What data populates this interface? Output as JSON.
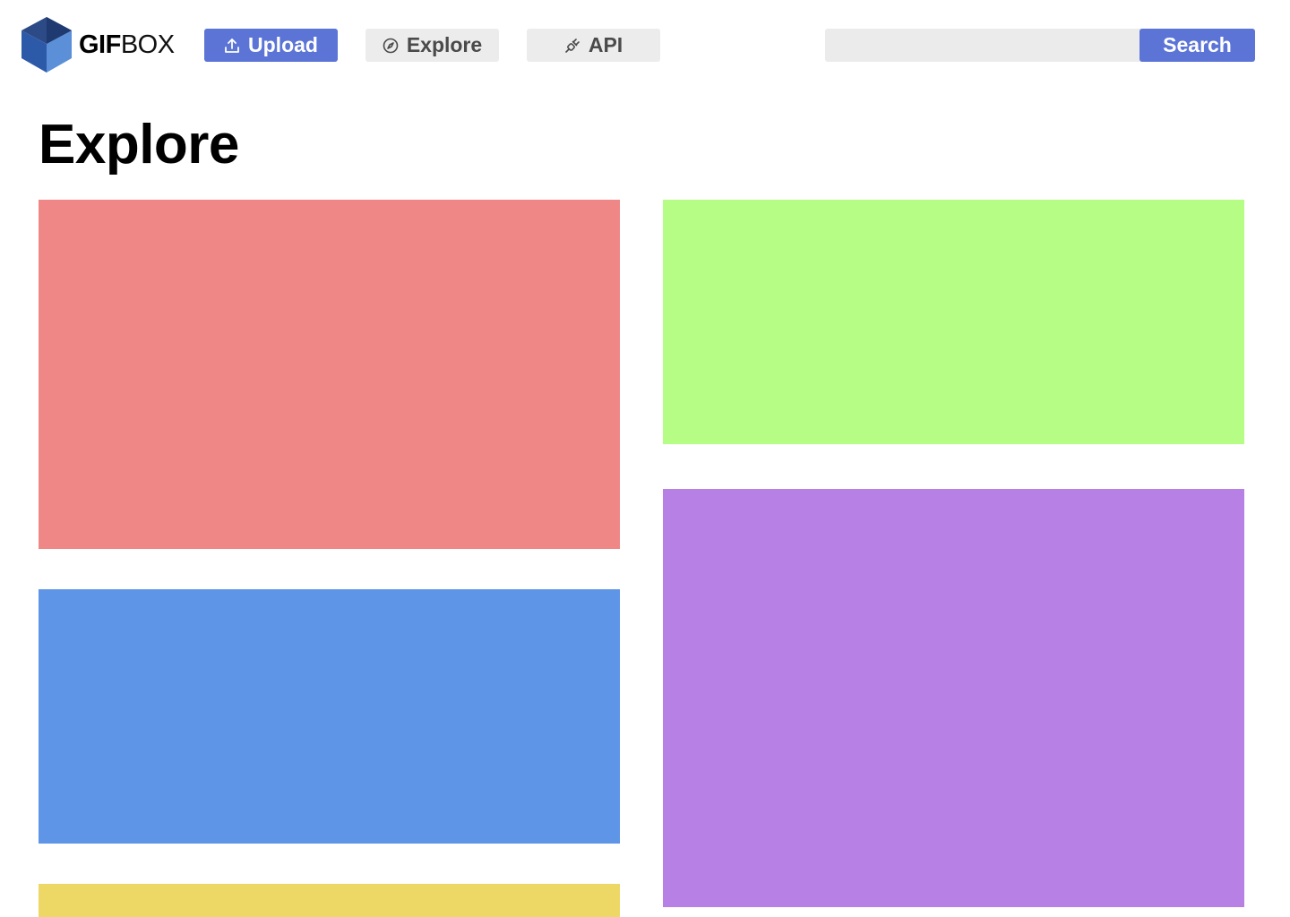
{
  "header": {
    "logo": {
      "text_bold": "GIF",
      "text_light": "BOX",
      "icon": "cube-logo-icon"
    },
    "nav": {
      "upload": {
        "label": "Upload",
        "icon": "upload-icon"
      },
      "explore": {
        "label": "Explore",
        "icon": "compass-icon"
      },
      "api": {
        "label": "API",
        "icon": "plug-icon"
      }
    },
    "search": {
      "placeholder": "",
      "value": "",
      "button_label": "Search"
    }
  },
  "main": {
    "title": "Explore",
    "gifs": [
      {
        "color": "#ef8787"
      },
      {
        "color": "#b5fd85"
      },
      {
        "color": "#5e95e6"
      },
      {
        "color": "#b780e4"
      },
      {
        "color": "#edd866"
      }
    ]
  },
  "colors": {
    "accent": "#5b74d6",
    "secondary_button": "#ececec",
    "search_field": "#ebebeb"
  }
}
